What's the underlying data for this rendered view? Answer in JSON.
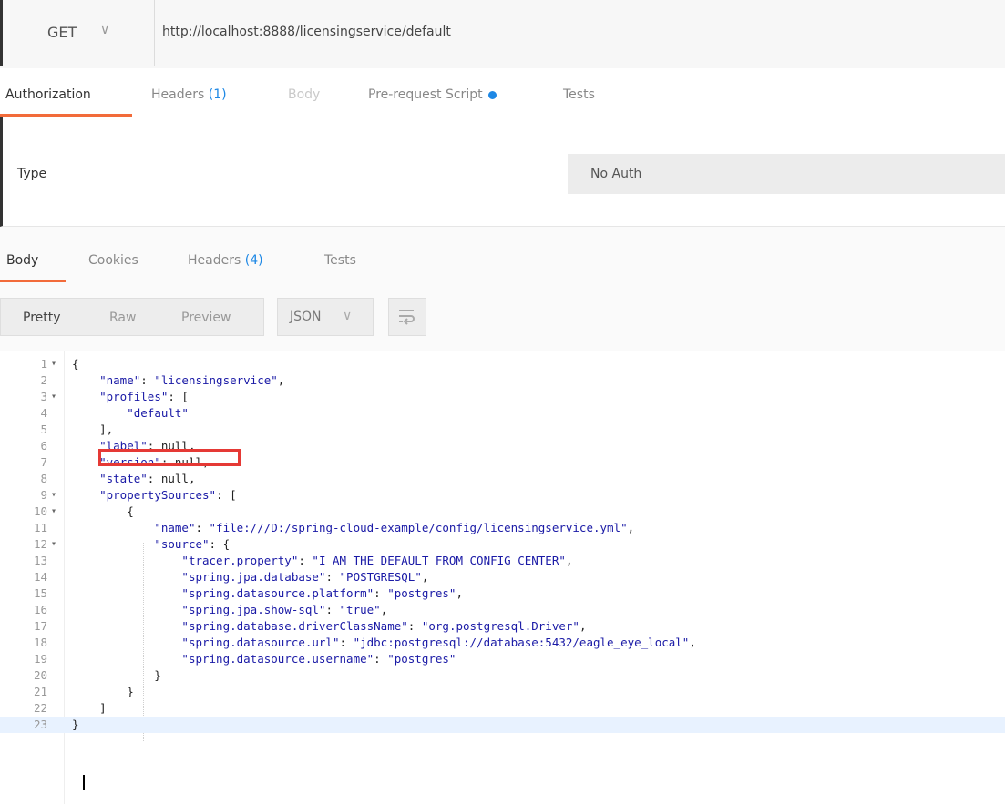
{
  "request": {
    "method": "GET",
    "url": "http://localhost:8888/licensingservice/default"
  },
  "request_tabs": [
    {
      "label": "Authorization",
      "active": true
    },
    {
      "label": "Headers",
      "count": "(1)"
    },
    {
      "label": "Body",
      "disabled": true
    },
    {
      "label": "Pre-request Script",
      "dot": true
    },
    {
      "label": "Tests"
    }
  ],
  "auth": {
    "type_label": "Type",
    "value": "No Auth"
  },
  "response_tabs": [
    {
      "label": "Body",
      "active": true
    },
    {
      "label": "Cookies"
    },
    {
      "label": "Headers",
      "count": "(4)"
    },
    {
      "label": "Tests"
    }
  ],
  "format": {
    "modes": [
      "Pretty",
      "Raw",
      "Preview"
    ],
    "active_mode": "Pretty",
    "language": "JSON"
  },
  "code": {
    "lines": [
      {
        "n": "1",
        "fold": true,
        "text": "{"
      },
      {
        "n": "2",
        "text": "    \"name\": \"licensingservice\","
      },
      {
        "n": "3",
        "fold": true,
        "text": "    \"profiles\": ["
      },
      {
        "n": "4",
        "text": "        \"default\""
      },
      {
        "n": "5",
        "text": "    ],"
      },
      {
        "n": "6",
        "text": "    \"label\": null,"
      },
      {
        "n": "7",
        "text": "    \"version\": null,"
      },
      {
        "n": "8",
        "text": "    \"state\": null,"
      },
      {
        "n": "9",
        "fold": true,
        "text": "    \"propertySources\": ["
      },
      {
        "n": "10",
        "fold": true,
        "text": "        {"
      },
      {
        "n": "11",
        "text": "            \"name\": \"file:///D:/spring-cloud-example/config/licensingservice.yml\","
      },
      {
        "n": "12",
        "fold": true,
        "text": "            \"source\": {"
      },
      {
        "n": "13",
        "text": "                \"tracer.property\": \"I AM THE DEFAULT FROM CONFIG CENTER\","
      },
      {
        "n": "14",
        "text": "                \"spring.jpa.database\": \"POSTGRESQL\","
      },
      {
        "n": "15",
        "text": "                \"spring.datasource.platform\": \"postgres\","
      },
      {
        "n": "16",
        "text": "                \"spring.jpa.show-sql\": \"true\","
      },
      {
        "n": "17",
        "text": "                \"spring.database.driverClassName\": \"org.postgresql.Driver\","
      },
      {
        "n": "18",
        "text": "                \"spring.datasource.url\": \"jdbc:postgresql://database:5432/eagle_eye_local\","
      },
      {
        "n": "19",
        "text": "                \"spring.datasource.username\": \"postgres\""
      },
      {
        "n": "20",
        "text": "            }"
      },
      {
        "n": "21",
        "text": "        }"
      },
      {
        "n": "22",
        "text": "    ]"
      },
      {
        "n": "23",
        "text": "}"
      }
    ]
  },
  "colors": {
    "accent_underline": "#f26b3a",
    "count_blue": "#1e88e5",
    "highlight_box": "#e53935"
  }
}
